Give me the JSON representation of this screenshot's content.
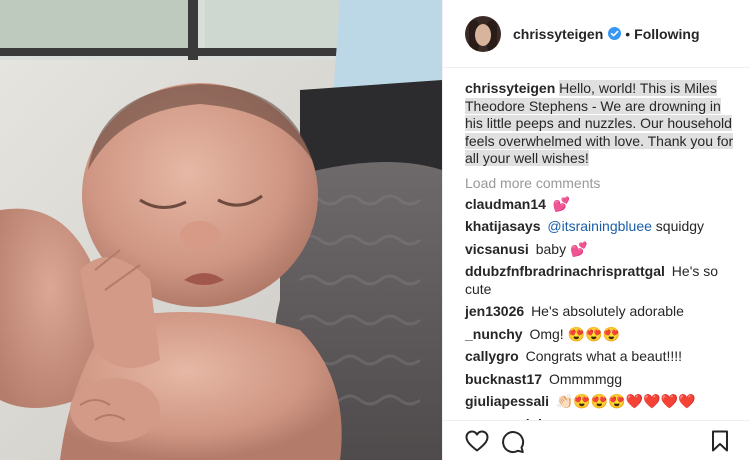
{
  "header": {
    "username": "chrissyteigen",
    "separator": "•",
    "follow_status": "Following",
    "verified_color": "#3897f0"
  },
  "caption": {
    "username": "chrissyteigen",
    "text": "Hello, world! This is Miles Theodore Stephens - We are drowning in his little peeps and nuzzles. Our household feels overwhelmed with love. Thank you for all your well wishes!"
  },
  "load_more_label": "Load more comments",
  "comments": [
    {
      "username": "claudman14",
      "text": "💕"
    },
    {
      "username": "khatijasays",
      "mention": "@itsrainingbluee",
      "text": "squidgy"
    },
    {
      "username": "vicsanusi",
      "text": "baby 💕"
    },
    {
      "username": "ddubzfnfbradrinachrisprattgal",
      "text": "He's so cute"
    },
    {
      "username": "jen13026",
      "text": "He's absolutely adorable"
    },
    {
      "username": "_nunchy",
      "text": "Omg! 😍😍😍"
    },
    {
      "username": "callygro",
      "text": "Congrats what a beaut!!!!"
    },
    {
      "username": "bucknast17",
      "text": "Ommmmgg"
    },
    {
      "username": "giuliapessali",
      "text": "👏🏻😍😍😍❤️❤️❤️❤️"
    },
    {
      "username": "maevannjohnson",
      "text": "gorgeous"
    }
  ],
  "icons": {
    "like": "heart-icon",
    "comment": "comment-icon",
    "save": "bookmark-icon"
  }
}
